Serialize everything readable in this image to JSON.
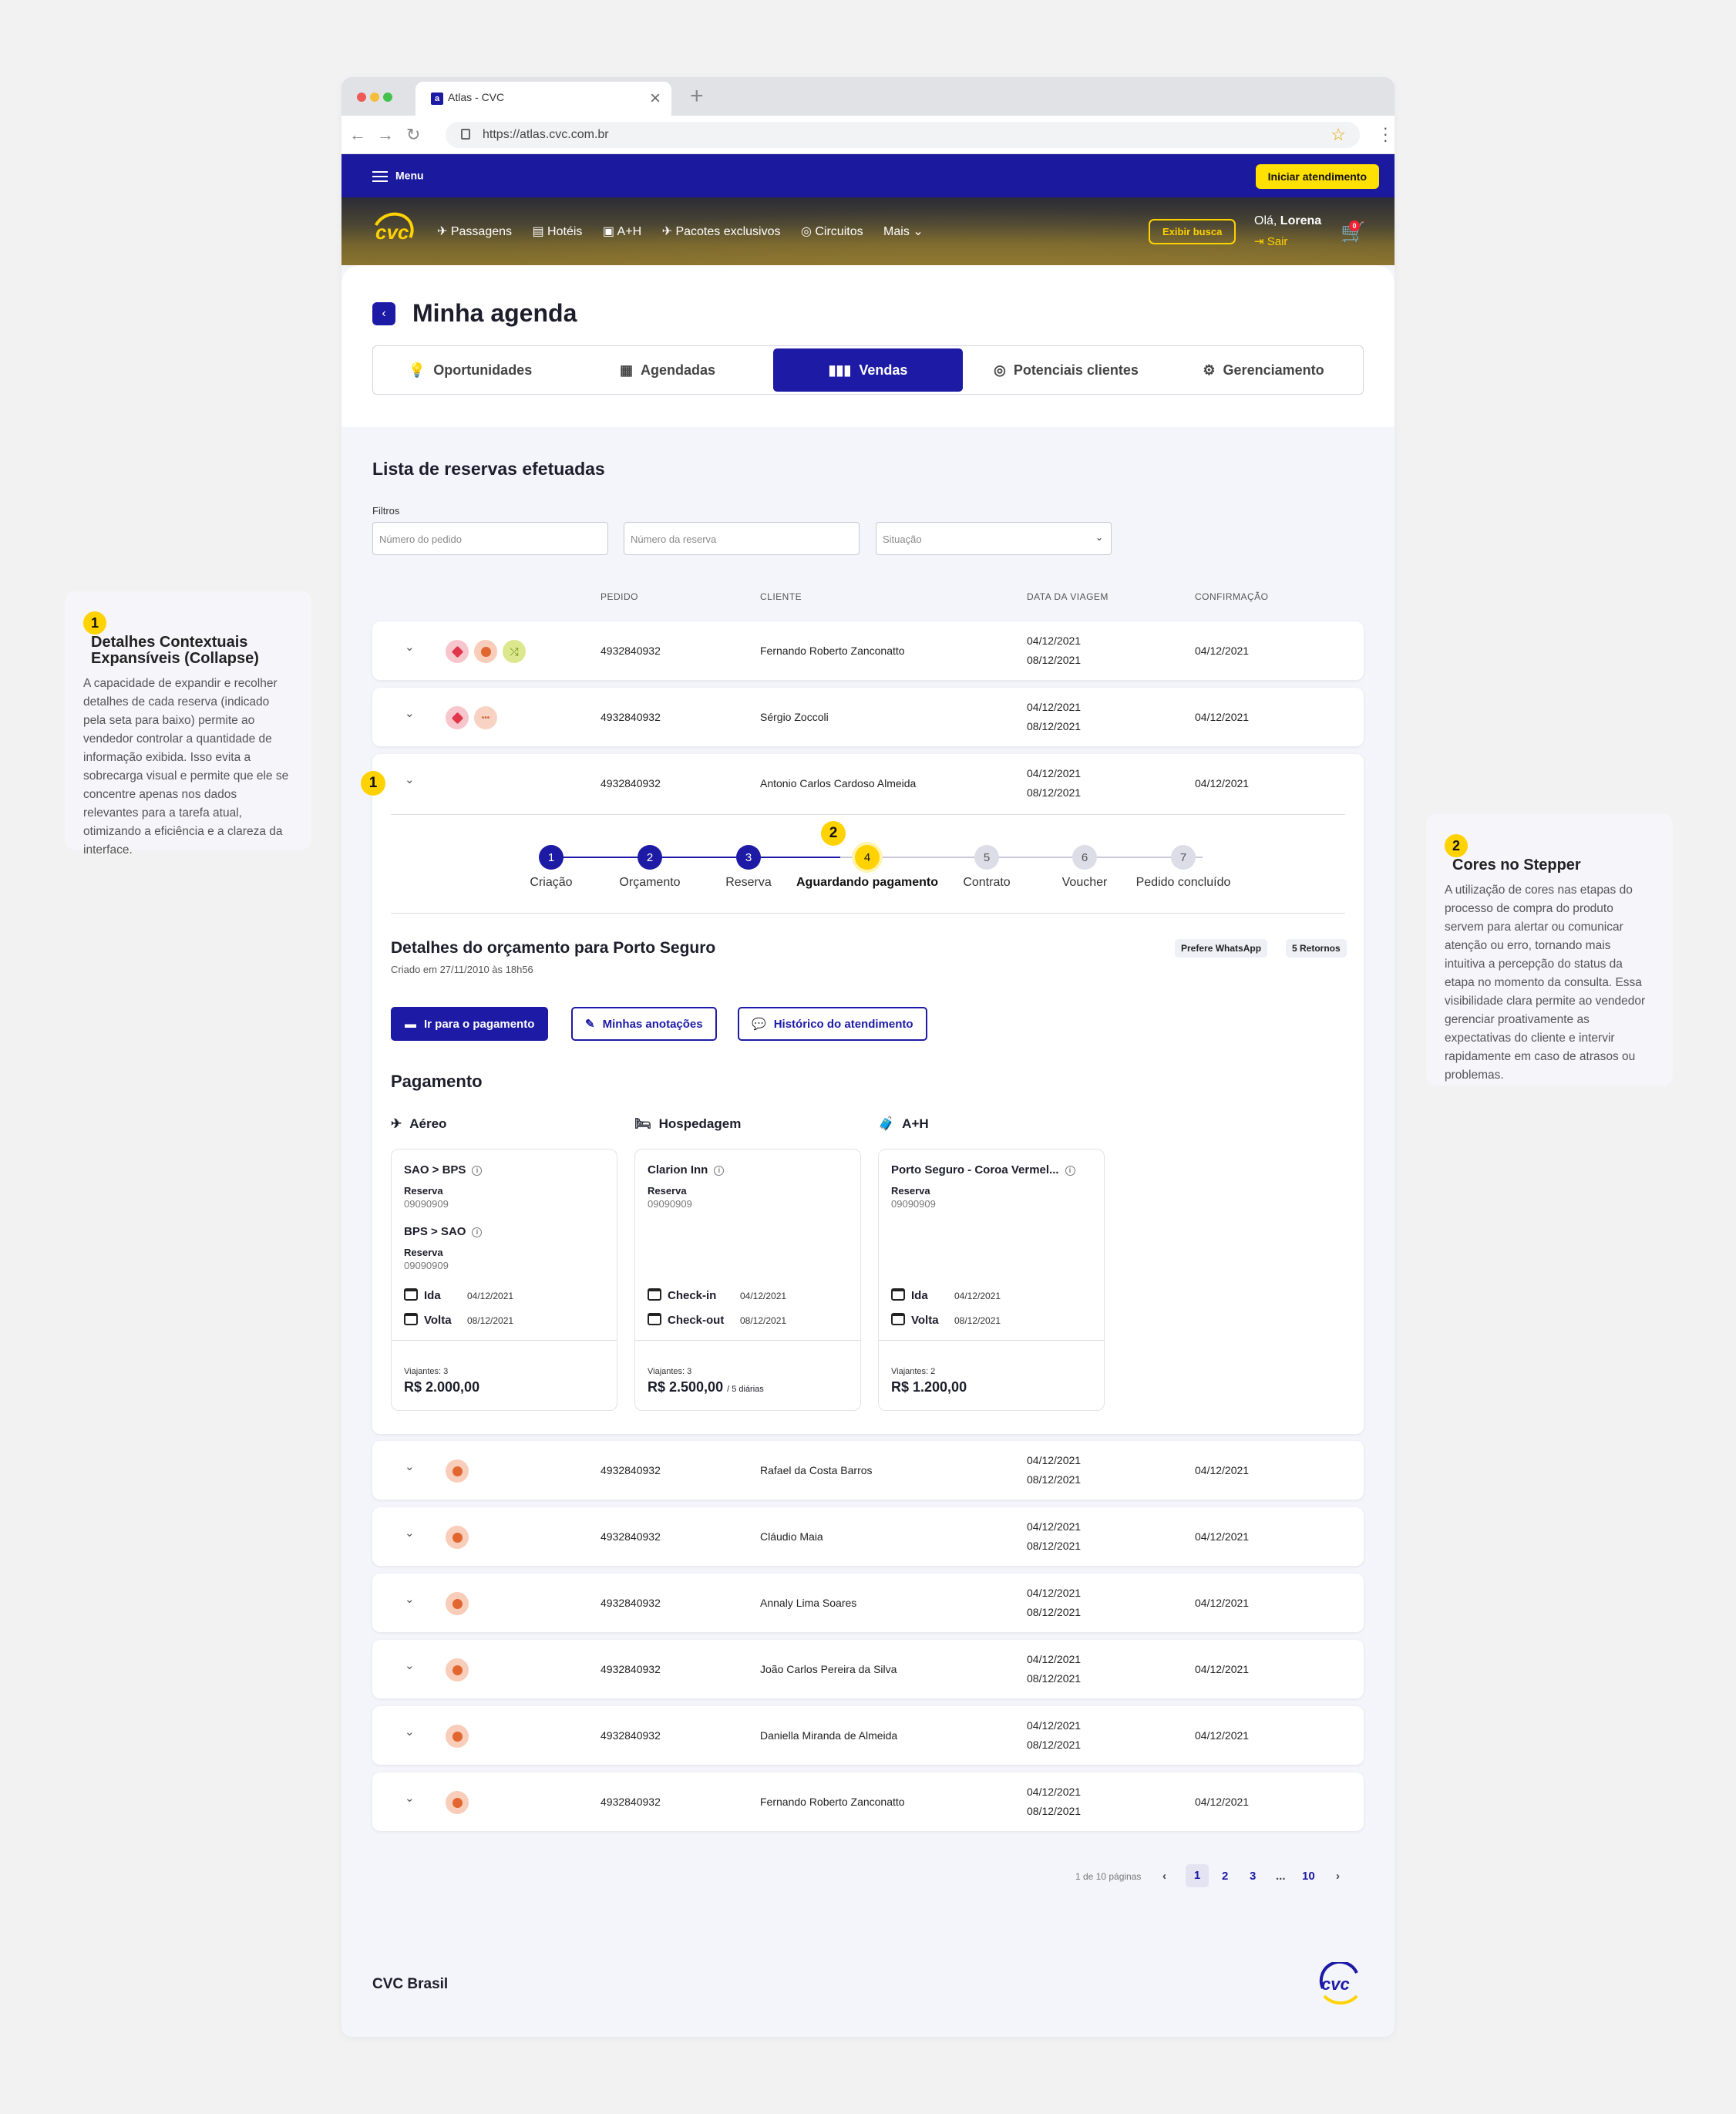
{
  "annotations": [
    {
      "num": "1",
      "title": "Detalhes Contextuais Expansíveis (Collapse)",
      "text": "A capacidade de expandir e recolher detalhes de cada reserva (indicado pela seta para baixo) permite ao vendedor controlar a quantidade de informação exibida. Isso evita a sobrecarga visual e permite que ele se concentre apenas nos dados relevantes para a tarefa atual, otimizando a eficiência e a clareza da interface."
    },
    {
      "num": "2",
      "title": "Cores no Stepper",
      "text": "A utilização de cores nas etapas do processo de compra do produto servem para alertar ou comunicar atenção ou erro, tornando mais intuitiva a percepção do status da etapa no momento da consulta. Essa visibilidade clara permite ao vendedor gerenciar proativamente as expectativas do cliente e intervir rapidamente em caso de atrasos ou problemas."
    }
  ],
  "browser": {
    "tab_title": "Atlas - CVC",
    "favicon": "a",
    "url": "https://atlas.cvc.com.br"
  },
  "topbar": {
    "menu": "Menu",
    "cta": "Iniciar atendimento"
  },
  "hero": {
    "logo": "cvc",
    "links": [
      "Passagens",
      "Hotéis",
      "A+H",
      "Pacotes exclusivos",
      "Circuitos",
      "Mais"
    ],
    "exibir": "Exibir busca",
    "greeting": "Olá,",
    "user": "Lorena",
    "logout": "Sair",
    "cart_count": "0"
  },
  "page": {
    "title": "Minha agenda"
  },
  "tabs": [
    {
      "label": "Oportunidades",
      "icon": "lightbulb-icon"
    },
    {
      "label": "Agendadas",
      "icon": "calendar-icon"
    },
    {
      "label": "Vendas",
      "icon": "bar-chart-icon"
    },
    {
      "label": "Potenciais clientes",
      "icon": "target-icon"
    },
    {
      "label": "Gerenciamento",
      "icon": "gear-icon"
    }
  ],
  "section": {
    "title": "Lista de reservas efetuadas",
    "filters_label": "Filtros"
  },
  "filters": {
    "pedido": "Número do pedido",
    "reserva": "Número da reserva",
    "situacao": "Situação"
  },
  "columns": {
    "pedido": "PEDIDO",
    "cliente": "CLIENTE",
    "data": "DATA DA VIAGEM",
    "confirmacao": "CONFIRMAÇÃO"
  },
  "rows_top": [
    {
      "pedido": "4932840932",
      "cliente": "Fernando Roberto Zanconatto",
      "ida": "04/12/2021",
      "volta": "08/12/2021",
      "conf": "04/12/2021"
    },
    {
      "pedido": "4932840932",
      "cliente": "Sérgio Zoccoli",
      "ida": "04/12/2021",
      "volta": "08/12/2021",
      "conf": "04/12/2021"
    }
  ],
  "expanded": {
    "pedido": "4932840932",
    "cliente": "Antonio Carlos Cardoso Almeida",
    "ida": "04/12/2021",
    "volta": "08/12/2021",
    "conf": "04/12/2021",
    "steps": [
      {
        "n": "1",
        "label": "Criação"
      },
      {
        "n": "2",
        "label": "Orçamento"
      },
      {
        "n": "3",
        "label": "Reserva"
      },
      {
        "n": "4",
        "label": "Aguardando pagamento"
      },
      {
        "n": "5",
        "label": "Contrato"
      },
      {
        "n": "6",
        "label": "Voucher"
      },
      {
        "n": "7",
        "label": "Pedido concluído"
      }
    ],
    "detail_title": "Detalhes do orçamento para Porto Seguro",
    "created": "Criado em 27/11/2010 às 18h56",
    "chips": [
      "Prefere WhatsApp",
      "5 Retornos"
    ],
    "buttons": [
      "Ir para o pagamento",
      "Minhas anotações",
      "Histórico do atendimento"
    ],
    "payment_title": "Pagamento",
    "categories": [
      "Aéreo",
      "Hospedagem",
      "A+H"
    ],
    "cards": {
      "aereo": {
        "t1": "SAO > BPS",
        "s1": "Reserva",
        "v1": "09090909",
        "t2": "BPS > SAO",
        "s2": "Reserva",
        "v2": "09090909",
        "l1": "Ida",
        "d1": "04/12/2021",
        "l2": "Volta",
        "d2": "08/12/2021",
        "via": "Viajantes: 3",
        "price": "R$ 2.000,00"
      },
      "hosp": {
        "t1": "Clarion Inn",
        "s1": "Reserva",
        "v1": "09090909",
        "l1": "Check-in",
        "d1": "04/12/2021",
        "l2": "Check-out",
        "d2": "08/12/2021",
        "via": "Viajantes: 3",
        "price": "R$ 2.500,00",
        "extra": "/ 5 diárias"
      },
      "ah": {
        "t1": "Porto Seguro - Coroa Vermel...",
        "s1": "Reserva",
        "v1": "09090909",
        "l1": "Ida",
        "d1": "04/12/2021",
        "l2": "Volta",
        "d2": "08/12/2021",
        "via": "Viajantes: 2",
        "price": "R$ 1.200,00"
      }
    }
  },
  "rows_bottom": [
    {
      "pedido": "4932840932",
      "cliente": "Rafael da Costa Barros",
      "ida": "04/12/2021",
      "volta": "08/12/2021",
      "conf": "04/12/2021"
    },
    {
      "pedido": "4932840932",
      "cliente": "Cláudio Maia",
      "ida": "04/12/2021",
      "volta": "08/12/2021",
      "conf": "04/12/2021"
    },
    {
      "pedido": "4932840932",
      "cliente": "Annaly Lima Soares",
      "ida": "04/12/2021",
      "volta": "08/12/2021",
      "conf": "04/12/2021"
    },
    {
      "pedido": "4932840932",
      "cliente": "João Carlos Pereira da Silva",
      "ida": "04/12/2021",
      "volta": "08/12/2021",
      "conf": "04/12/2021"
    },
    {
      "pedido": "4932840932",
      "cliente": "Daniella Miranda de Almeida",
      "ida": "04/12/2021",
      "volta": "08/12/2021",
      "conf": "04/12/2021"
    },
    {
      "pedido": "4932840932",
      "cliente": "Fernando Roberto Zanconatto",
      "ida": "04/12/2021",
      "volta": "08/12/2021",
      "conf": "04/12/2021"
    }
  ],
  "pagination": {
    "info": "1 de 10 páginas",
    "pages": [
      "1",
      "2",
      "3",
      "...",
      "10"
    ]
  },
  "footer": {
    "brand": "CVC Brasil",
    "logo": "cvc"
  },
  "colors": {
    "primary": "#1d1aa5",
    "accent": "#ffd200",
    "error": "#e0364a",
    "warning": "#e2662f",
    "success": "#9bbd2c"
  }
}
